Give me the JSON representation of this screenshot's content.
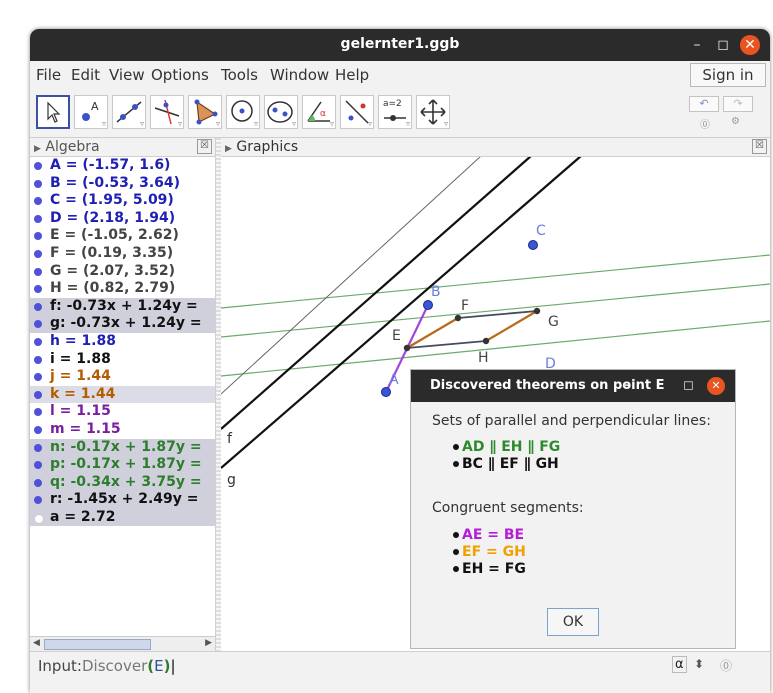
{
  "window": {
    "title": "gelernter1.ggb",
    "controls": {
      "minimize": "–",
      "maximize": "◻",
      "close": "✕"
    }
  },
  "menu": {
    "items": [
      "File",
      "Edit",
      "View",
      "Options",
      "Tools",
      "Window",
      "Help"
    ],
    "sign_in": "Sign in"
  },
  "toolbar": {
    "tools": [
      "move",
      "point",
      "line",
      "perpendicular-line",
      "polygon",
      "circle",
      "conic",
      "angle",
      "reflect",
      "slider",
      "move-graphics-view"
    ],
    "slider_label": "a=2",
    "undo": "↶",
    "redo": "↷",
    "help": "⓪",
    "settings": "⚙"
  },
  "algebra": {
    "header": "Algebra",
    "close": "☒",
    "objects": [
      {
        "text": "A = (-1.57, 1.6)",
        "color": "#1f1fb4",
        "dot": "#5050d8",
        "hl": ""
      },
      {
        "text": "B = (-0.53, 3.64)",
        "color": "#1f1fb4",
        "dot": "#5050d8",
        "hl": ""
      },
      {
        "text": "C = (1.95, 5.09)",
        "color": "#1f1fb4",
        "dot": "#5050d8",
        "hl": ""
      },
      {
        "text": "D = (2.18, 1.94)",
        "color": "#1f1fb4",
        "dot": "#5050d8",
        "hl": ""
      },
      {
        "text": "E = (-1.05, 2.62)",
        "color": "#444444",
        "dot": "#5050d8",
        "hl": ""
      },
      {
        "text": "F = (0.19, 3.35)",
        "color": "#444444",
        "dot": "#5050d8",
        "hl": ""
      },
      {
        "text": "G = (2.07, 3.52)",
        "color": "#444444",
        "dot": "#5050d8",
        "hl": ""
      },
      {
        "text": "H = (0.82, 2.79)",
        "color": "#444444",
        "dot": "#5050d8",
        "hl": ""
      },
      {
        "text": "f: -0.73x + 1.24y =",
        "color": "#111111",
        "dot": "#5050d8",
        "hl": "hl"
      },
      {
        "text": "g: -0.73x + 1.24y =",
        "color": "#111111",
        "dot": "#5050d8",
        "hl": "hl"
      },
      {
        "text": "h = 1.88",
        "color": "#1f1fb4",
        "dot": "#5050d8",
        "hl": ""
      },
      {
        "text": "i = 1.88",
        "color": "#111111",
        "dot": "#5050d8",
        "hl": ""
      },
      {
        "text": "j = 1.44",
        "color": "#b35c00",
        "dot": "#5050d8",
        "hl": ""
      },
      {
        "text": "k = 1.44",
        "color": "#b35c00",
        "dot": "#5050d8",
        "hl": "hl2"
      },
      {
        "text": "l = 1.15",
        "color": "#7a1fa0",
        "dot": "#5050d8",
        "hl": ""
      },
      {
        "text": "m = 1.15",
        "color": "#7a1fa0",
        "dot": "#5050d8",
        "hl": ""
      },
      {
        "text": "n: -0.17x + 1.87y =",
        "color": "#2d7d2d",
        "dot": "#5050d8",
        "hl": "hl"
      },
      {
        "text": "p: -0.17x + 1.87y =",
        "color": "#2d7d2d",
        "dot": "#5050d8",
        "hl": "hl"
      },
      {
        "text": "q: -0.34x + 3.75y =",
        "color": "#2d7d2d",
        "dot": "#5050d8",
        "hl": "hl"
      },
      {
        "text": "r: -1.45x + 2.49y =",
        "color": "#111111",
        "dot": "#5050d8",
        "hl": "hl"
      },
      {
        "text": "a = 2.72",
        "color": "#111111",
        "dot": "#ffffff",
        "hl": "hl"
      }
    ]
  },
  "graphics": {
    "header": "Graphics",
    "close": "☒",
    "points": [
      "A",
      "B",
      "C",
      "D",
      "E",
      "F",
      "G",
      "H"
    ],
    "line_labels": [
      "f",
      "g"
    ]
  },
  "dialog": {
    "title": "Discovered theorems on point E",
    "controls": {
      "minimize": "–",
      "maximize": "◻",
      "close": "✕"
    },
    "section1": "Sets of parallel and perpendicular lines:",
    "parallel": [
      {
        "text": "AD ∥ EH ∥ FG",
        "color": "#2d8a2d"
      },
      {
        "text": "BC ∥ EF ∥ GH",
        "color": "#111111"
      }
    ],
    "section2": "Congruent segments:",
    "congruent": [
      {
        "text": "AE = BE",
        "color": "#b21fd6"
      },
      {
        "text": "EF = GH",
        "color": "#f0a000"
      },
      {
        "text": "EH = FG",
        "color": "#111111"
      }
    ],
    "ok": "OK"
  },
  "input": {
    "label": "Input:",
    "command": "Discover",
    "open": "(",
    "arg": "E",
    "close": ")",
    "alpha": "α",
    "spinner": "⬍",
    "help": "⓪"
  }
}
